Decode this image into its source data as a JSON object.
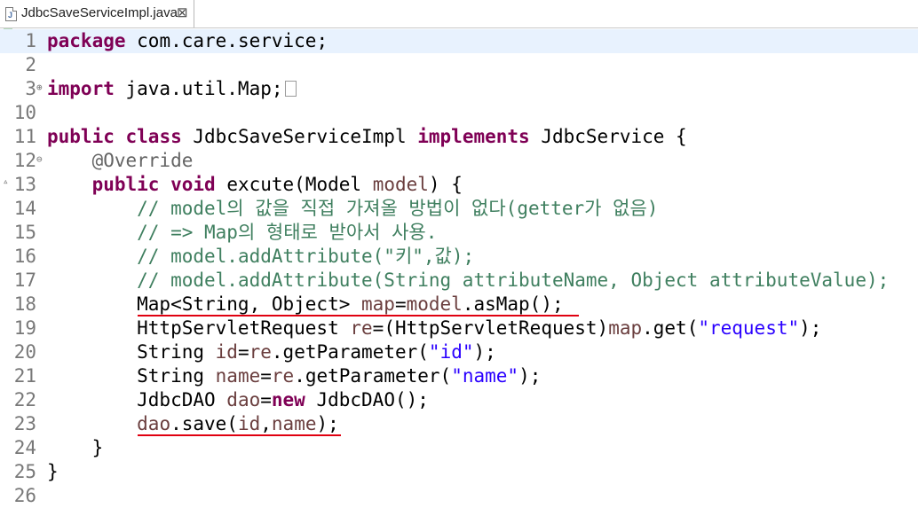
{
  "tab": {
    "title": "JdbcSaveServiceImpl.java",
    "close_label": "⊠",
    "icon": "java-file-icon"
  },
  "markers": {
    "fold": "⊕",
    "fold_open": "⊖",
    "override": "▵"
  },
  "lines": [
    {
      "num": "1",
      "tokens": [
        {
          "t": "package",
          "c": "kw"
        },
        {
          "t": " com.care.service;"
        }
      ]
    },
    {
      "num": "2",
      "tokens": []
    },
    {
      "num": "3",
      "tokens": [
        {
          "t": "import",
          "c": "kw"
        },
        {
          "t": " java.util.Map;"
        }
      ]
    },
    {
      "num": "10",
      "tokens": []
    },
    {
      "num": "11",
      "tokens": [
        {
          "t": "public",
          "c": "kw"
        },
        {
          "t": " "
        },
        {
          "t": "class",
          "c": "kw"
        },
        {
          "t": " JdbcSaveServiceImpl "
        },
        {
          "t": "implements",
          "c": "kw"
        },
        {
          "t": " JdbcService {"
        }
      ]
    },
    {
      "num": "12",
      "tokens": [
        {
          "t": "    "
        },
        {
          "t": "@Override",
          "c": "an"
        }
      ]
    },
    {
      "num": "13",
      "tokens": [
        {
          "t": "    "
        },
        {
          "t": "public",
          "c": "kw"
        },
        {
          "t": " "
        },
        {
          "t": "void",
          "c": "kw"
        },
        {
          "t": " excute(Model "
        },
        {
          "t": "model",
          "c": "vr"
        },
        {
          "t": ") {"
        }
      ]
    },
    {
      "num": "14",
      "tokens": [
        {
          "t": "        "
        },
        {
          "t": "// model의 값을 직접 가져올 방법이 없다(getter가 없음)",
          "c": "cm"
        }
      ]
    },
    {
      "num": "15",
      "tokens": [
        {
          "t": "        "
        },
        {
          "t": "// => Map의 형태로 받아서 사용.",
          "c": "cm"
        }
      ]
    },
    {
      "num": "16",
      "tokens": [
        {
          "t": "        "
        },
        {
          "t": "// model.addAttribute(\"키\",값);",
          "c": "cm"
        }
      ]
    },
    {
      "num": "17",
      "tokens": [
        {
          "t": "        "
        },
        {
          "t": "// model.addAttribute(String attributeName, Object attributeValue);",
          "c": "cm"
        }
      ]
    },
    {
      "num": "18",
      "tokens": [
        {
          "t": "        Map<String, Object> "
        },
        {
          "t": "map",
          "c": "vr"
        },
        {
          "t": "="
        },
        {
          "t": "model",
          "c": "vr"
        },
        {
          "t": ".asMap();"
        }
      ]
    },
    {
      "num": "19",
      "tokens": [
        {
          "t": "        HttpServletRequest "
        },
        {
          "t": "re",
          "c": "vr"
        },
        {
          "t": "=(HttpServletRequest)"
        },
        {
          "t": "map",
          "c": "vr"
        },
        {
          "t": ".get("
        },
        {
          "t": "\"request\"",
          "c": "st"
        },
        {
          "t": ");"
        }
      ]
    },
    {
      "num": "20",
      "tokens": [
        {
          "t": "        String "
        },
        {
          "t": "id",
          "c": "vr"
        },
        {
          "t": "="
        },
        {
          "t": "re",
          "c": "vr"
        },
        {
          "t": ".getParameter("
        },
        {
          "t": "\"id\"",
          "c": "st"
        },
        {
          "t": ");"
        }
      ]
    },
    {
      "num": "21",
      "tokens": [
        {
          "t": "        String "
        },
        {
          "t": "name",
          "c": "vr"
        },
        {
          "t": "="
        },
        {
          "t": "re",
          "c": "vr"
        },
        {
          "t": ".getParameter("
        },
        {
          "t": "\"name\"",
          "c": "st"
        },
        {
          "t": ");"
        }
      ]
    },
    {
      "num": "22",
      "tokens": [
        {
          "t": "        JdbcDAO "
        },
        {
          "t": "dao",
          "c": "vr"
        },
        {
          "t": "="
        },
        {
          "t": "new",
          "c": "kw"
        },
        {
          "t": " JdbcDAO();"
        }
      ]
    },
    {
      "num": "23",
      "tokens": [
        {
          "t": "        "
        },
        {
          "t": "dao",
          "c": "vr"
        },
        {
          "t": ".save("
        },
        {
          "t": "id",
          "c": "vr"
        },
        {
          "t": ","
        },
        {
          "t": "name",
          "c": "vr"
        },
        {
          "t": ");"
        }
      ]
    },
    {
      "num": "24",
      "tokens": [
        {
          "t": "    }"
        }
      ]
    },
    {
      "num": "25",
      "tokens": [
        {
          "t": "}"
        }
      ]
    },
    {
      "num": "26",
      "tokens": []
    }
  ],
  "colors": {
    "keyword": "#7f0055",
    "comment": "#3f7f5f",
    "string": "#2a00ff",
    "variable": "#6a3e3e",
    "annotation": "#646464",
    "underline": "#e00010",
    "current_line": "#e8f2fe"
  }
}
